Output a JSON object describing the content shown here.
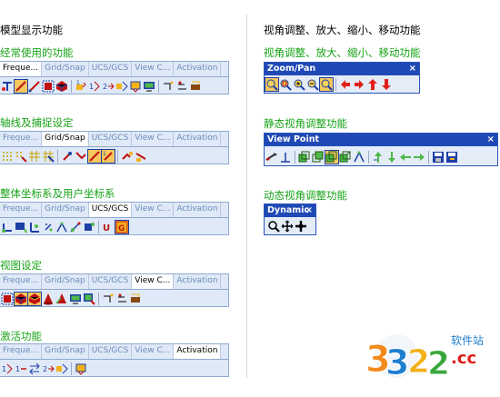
{
  "left": {
    "title": "模型显示功能",
    "tabs": [
      "Freque...",
      "Grid/Snap",
      "UCS/GCS",
      "View C...",
      "Activation"
    ],
    "sections": [
      {
        "title": "经常使用的功能",
        "active_tab": 0
      },
      {
        "title": "轴线及捕捉设定",
        "active_tab": 1
      },
      {
        "title": "整体坐标系及用户坐标系",
        "active_tab": 2
      },
      {
        "title": "视图设定",
        "active_tab": 3
      },
      {
        "title": "激活功能",
        "active_tab": 4
      }
    ]
  },
  "right": {
    "title": "视角调整、放大、缩小、移动功能",
    "sections": [
      {
        "title": "视角调整、放大、缩小、移动功能",
        "toolbar_title": "Zoom/Pan",
        "close": "×"
      },
      {
        "title": "静态视角调整功能",
        "toolbar_title": "View Point",
        "close": "×"
      },
      {
        "title": "动态视角调整功能",
        "toolbar_title": "Dynamic",
        "close": "×"
      }
    ]
  },
  "watermark": {
    "number": "3322",
    "domain": ".cc",
    "site": "软件站"
  },
  "colors": {
    "section_title": "#16a316",
    "tab_bg": "#dfe9f7",
    "toolbar_titlebar": "#1f49b4",
    "arrow_red": "#e0201b"
  }
}
